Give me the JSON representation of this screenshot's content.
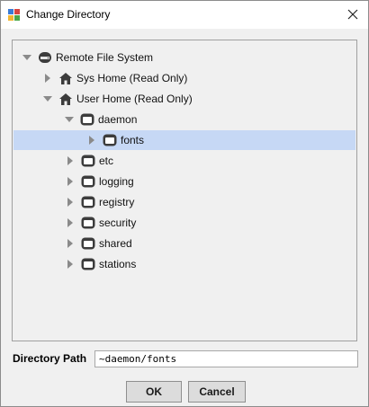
{
  "window": {
    "title": "Change Directory"
  },
  "tree": {
    "nodes": [
      {
        "label": "Remote File System",
        "icon": "remote-drive-icon",
        "expanded": true
      },
      {
        "label": "Sys Home (Read Only)",
        "icon": "home-icon",
        "expanded": false
      },
      {
        "label": "User Home (Read Only)",
        "icon": "home-icon",
        "expanded": true
      },
      {
        "label": "daemon",
        "icon": "folder-icon",
        "expanded": true
      },
      {
        "label": "fonts",
        "icon": "folder-icon",
        "expanded": false,
        "selected": true
      },
      {
        "label": "etc",
        "icon": "folder-icon",
        "expanded": false
      },
      {
        "label": "logging",
        "icon": "folder-icon",
        "expanded": false
      },
      {
        "label": "registry",
        "icon": "folder-icon",
        "expanded": false
      },
      {
        "label": "security",
        "icon": "folder-icon",
        "expanded": false
      },
      {
        "label": "shared",
        "icon": "folder-icon",
        "expanded": false
      },
      {
        "label": "stations",
        "icon": "folder-icon",
        "expanded": false
      }
    ]
  },
  "directory_path": {
    "label": "Directory Path",
    "value": "~daemon/fonts"
  },
  "buttons": {
    "ok": "OK",
    "cancel": "Cancel"
  },
  "colors": {
    "selection": "#c6d8f5",
    "dialog_background": "#f0f0f0"
  }
}
